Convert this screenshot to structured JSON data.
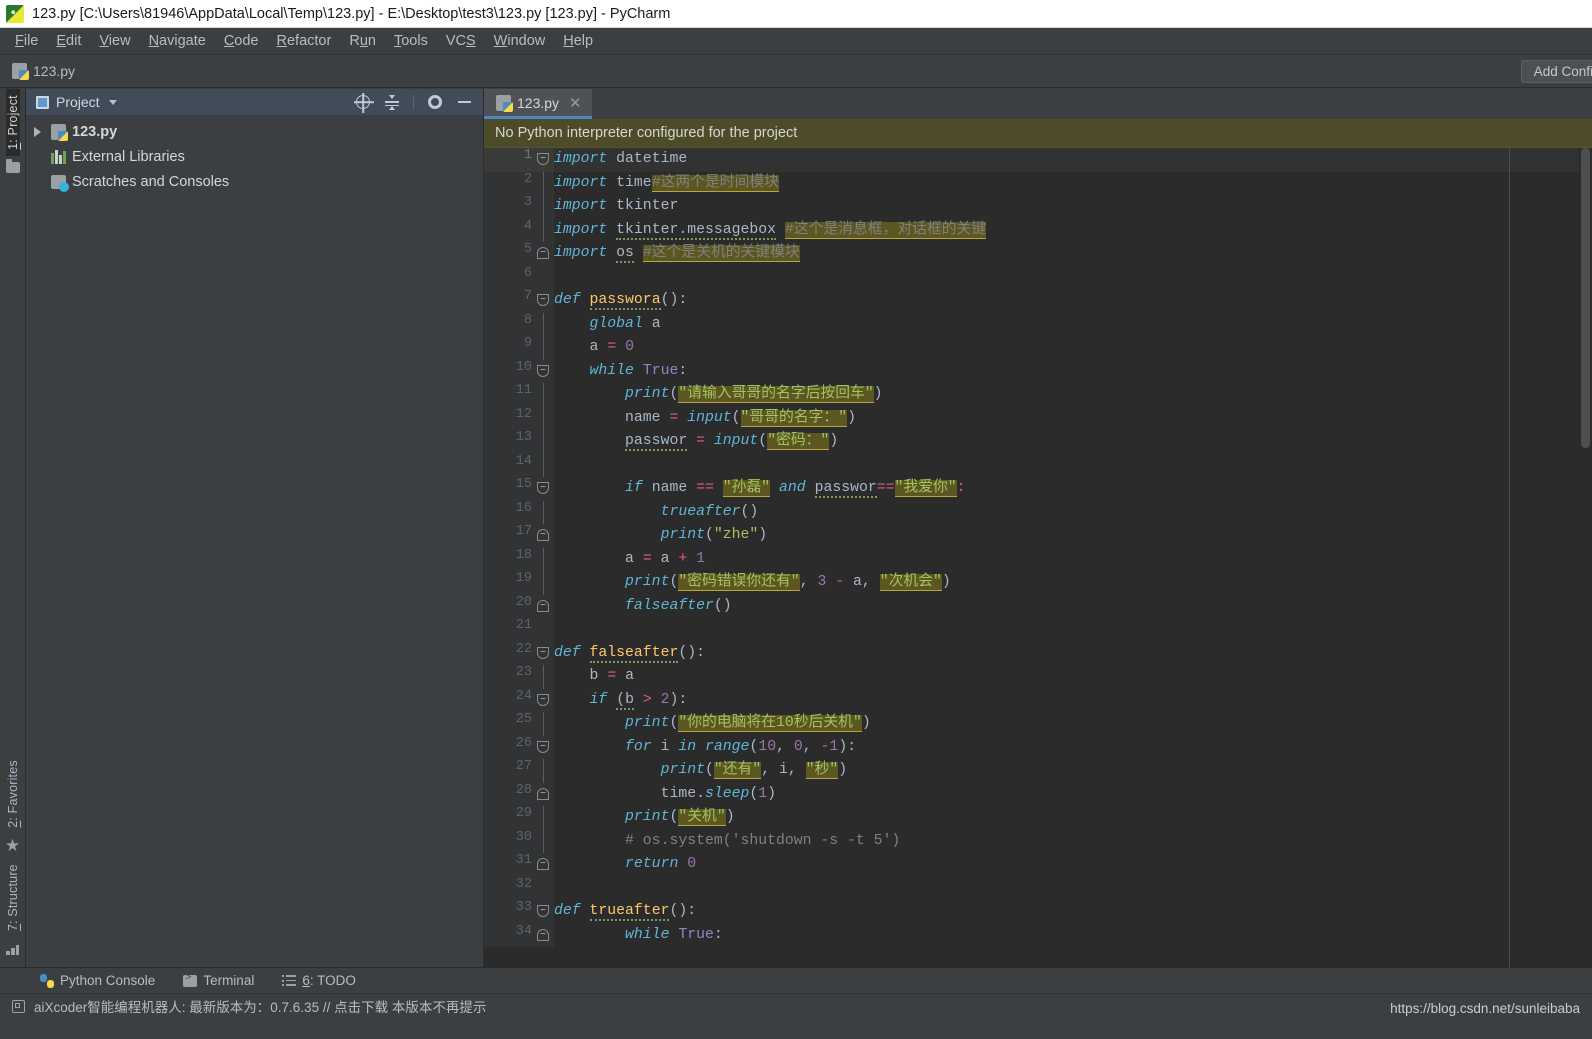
{
  "window": {
    "title": "123.py [C:\\Users\\81946\\AppData\\Local\\Temp\\123.py] - E:\\Desktop\\test3\\123.py [123.py] - PyCharm",
    "app_icon": "pycharm-icon"
  },
  "menubar": {
    "items": [
      {
        "label": "File",
        "mnemonic": "F"
      },
      {
        "label": "Edit",
        "mnemonic": "E"
      },
      {
        "label": "View",
        "mnemonic": "V"
      },
      {
        "label": "Navigate",
        "mnemonic": "N"
      },
      {
        "label": "Code",
        "mnemonic": "C"
      },
      {
        "label": "Refactor",
        "mnemonic": "R"
      },
      {
        "label": "Run",
        "mnemonic": "u"
      },
      {
        "label": "Tools",
        "mnemonic": "T"
      },
      {
        "label": "VCS",
        "mnemonic": "S"
      },
      {
        "label": "Window",
        "mnemonic": "W"
      },
      {
        "label": "Help",
        "mnemonic": "H"
      }
    ]
  },
  "navbar": {
    "breadcrumb": "123.py",
    "add_configuration_label": "Add Confi"
  },
  "left_strip": {
    "top_tab": "1: Project",
    "bottom_tabs": [
      "2: Favorites",
      "7: Structure"
    ]
  },
  "project_panel": {
    "title": "Project",
    "toolbar_icons": [
      "locate-icon",
      "collapse-all-icon",
      "settings-gear-icon",
      "hide-panel-icon"
    ],
    "tree": [
      {
        "label": "123.py",
        "icon": "python-folder-icon",
        "bold": true,
        "expandable": true
      },
      {
        "label": "External Libraries",
        "icon": "libraries-icon",
        "bold": false,
        "expandable": false
      },
      {
        "label": "Scratches and Consoles",
        "icon": "scratches-icon",
        "bold": false,
        "expandable": false
      }
    ]
  },
  "editor": {
    "tab": {
      "label": "123.py",
      "icon": "python-file-icon",
      "close_icon": "close-icon"
    },
    "banner": "No Python interpreter configured for the project",
    "lines": [
      {
        "n": "1",
        "fold": "open"
      },
      {
        "n": "2",
        "fold": ""
      },
      {
        "n": "3",
        "fold": ""
      },
      {
        "n": "4",
        "fold": ""
      },
      {
        "n": "5",
        "fold": "close"
      },
      {
        "n": "6",
        "fold": ""
      },
      {
        "n": "7",
        "fold": "open"
      },
      {
        "n": "8",
        "fold": ""
      },
      {
        "n": "9",
        "fold": ""
      },
      {
        "n": "10",
        "fold": "open"
      },
      {
        "n": "11",
        "fold": ""
      },
      {
        "n": "12",
        "fold": ""
      },
      {
        "n": "13",
        "fold": ""
      },
      {
        "n": "14",
        "fold": ""
      },
      {
        "n": "15",
        "fold": "open"
      },
      {
        "n": "16",
        "fold": ""
      },
      {
        "n": "17",
        "fold": "close"
      },
      {
        "n": "18",
        "fold": ""
      },
      {
        "n": "19",
        "fold": ""
      },
      {
        "n": "20",
        "fold": "close"
      },
      {
        "n": "21",
        "fold": ""
      },
      {
        "n": "22",
        "fold": "open"
      },
      {
        "n": "23",
        "fold": ""
      },
      {
        "n": "24",
        "fold": "open"
      },
      {
        "n": "25",
        "fold": ""
      },
      {
        "n": "26",
        "fold": "open"
      },
      {
        "n": "27",
        "fold": ""
      },
      {
        "n": "28",
        "fold": "close"
      },
      {
        "n": "29",
        "fold": ""
      },
      {
        "n": "30",
        "fold": ""
      },
      {
        "n": "31",
        "fold": "close"
      },
      {
        "n": "32",
        "fold": ""
      },
      {
        "n": "33",
        "fold": "open"
      },
      {
        "n": "34",
        "fold": "close"
      }
    ],
    "source_text": [
      "import datetime",
      "import time#这两个是时间模块",
      "import tkinter",
      "import tkinter.messagebox #这个是消息框，对话框的关键",
      "import os #这个是关机的关键模块",
      "",
      "def passwora():",
      "    global a",
      "    a = 0",
      "    while True:",
      "        print(\"请输入哥哥的名字后按回车\")",
      "        name = input(\"哥哥的名字：\")",
      "        passwor = input(\"密码：\")",
      "",
      "        if name == \"孙磊\" and passwor==\"我爱你\":",
      "            trueafter()",
      "            print(\"zhe\")",
      "        a = a + 1",
      "        print(\"密码错误你还有\", 3 - a, \"次机会\")",
      "        falseafter()",
      "",
      "def falseafter():",
      "    b = a",
      "    if (b > 2):",
      "        print(\"你的电脑将在10秒后关机\")",
      "        for i in range(10, 0, -1):",
      "            print(\"还有\", i, \"秒\")",
      "            time.sleep(1)",
      "        print(\"关机\")",
      "        # os.system('shutdown -s -t 5')",
      "        return 0",
      "",
      "def trueafter():",
      "        while True:"
    ]
  },
  "bottom": {
    "tool_windows": [
      {
        "label": "Python Console",
        "icon": "python-console-icon"
      },
      {
        "label": "Terminal",
        "icon": "terminal-icon"
      },
      {
        "label": "6: TODO",
        "icon": "todo-icon"
      }
    ],
    "status_message": "aiXcoder智能编程机器人: 最新版本为：0.7.6.35 // 点击下载 本版本不再提示",
    "status_icon": "aixcoder-icon",
    "watermark": "https://blog.csdn.net/sunleibaba"
  },
  "colors": {
    "accent_blue": "#4a88c7",
    "banner_bg": "#4e4b28",
    "editor_bg": "#2b2b2b",
    "panel_bg": "#3c3f41",
    "string_green": "#a5c261",
    "keyword_orange": "#cc7832",
    "highlight_olive": "#5c5621"
  }
}
